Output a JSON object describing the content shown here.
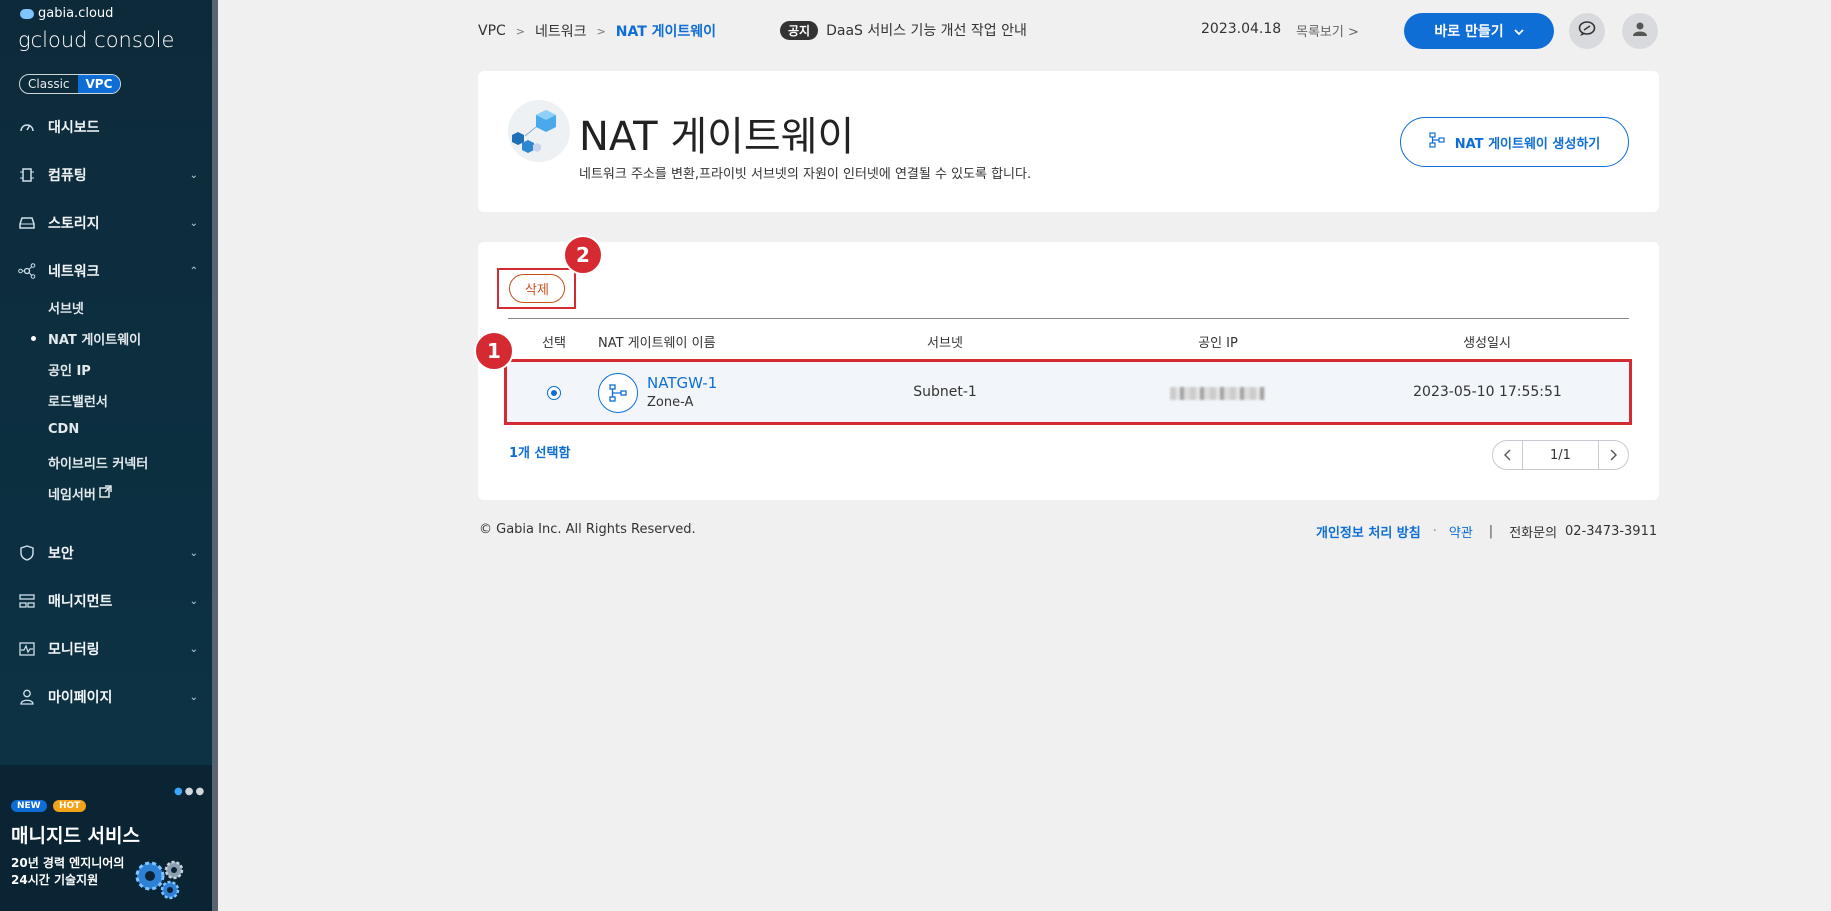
{
  "sidebar": {
    "brand_small": "gabia.cloud",
    "brand_big": "gcloud console",
    "mode_classic": "Classic",
    "mode_vpc": "VPC",
    "items": [
      {
        "label": "대시보드",
        "icon": "dashboard-icon"
      },
      {
        "label": "컴퓨팅",
        "icon": "chip-icon"
      },
      {
        "label": "스토리지",
        "icon": "storage-icon"
      },
      {
        "label": "네트워크",
        "icon": "network-icon"
      },
      {
        "label": "보안",
        "icon": "shield-icon"
      },
      {
        "label": "매니지먼트",
        "icon": "management-icon"
      },
      {
        "label": "모니터링",
        "icon": "monitor-icon"
      },
      {
        "label": "마이페이지",
        "icon": "user-icon"
      }
    ],
    "network_sub": [
      "서브넷",
      "NAT 게이트웨이",
      "공인 IP",
      "로드밸런서",
      "CDN",
      "하이브리드 커넥터",
      "네임서버"
    ],
    "promo": {
      "badge_new": "NEW",
      "badge_hot": "HOT",
      "title": "매니지드 서비스",
      "line1": "20년 경력 엔지니어의",
      "line2": "24시간 기술지원"
    }
  },
  "topbar": {
    "breadcrumb": [
      "VPC",
      "네트워크",
      "NAT 게이트웨이"
    ],
    "notice_tag": "공지",
    "notice_text": "DaaS 서비스 기능 개선 작업 안내",
    "notice_date": "2023.04.18",
    "notice_more": "목록보기",
    "quick_button": "바로 만들기"
  },
  "header": {
    "title": "NAT 게이트웨이",
    "description": "네트워크 주소를 변환,프라이빗 서브넷의 자원이 인터넷에 연결될 수 있도록 합니다.",
    "create_button": "NAT 게이트웨이 생성하기"
  },
  "list": {
    "delete_button": "삭제",
    "markers": [
      "1",
      "2"
    ],
    "columns": [
      "선택",
      "NAT 게이트웨이 이름",
      "서브넷",
      "공인 IP",
      "생성일시"
    ],
    "rows": [
      {
        "name": "NATGW-1",
        "zone": "Zone-A",
        "subnet": "Subnet-1",
        "created": "2023-05-10 17:55:51",
        "selected": true
      }
    ],
    "selected_count": "1개 선택함",
    "page_label": "1/1"
  },
  "footer": {
    "copyright": "© Gabia Inc. All Rights Reserved.",
    "privacy": "개인정보 처리 방침",
    "terms": "약관",
    "phone_label": "전화문의",
    "phone": "02-3473-3911"
  },
  "colors": {
    "accent": "#0f6ed6",
    "highlight": "#d62a33",
    "sidebar": "#0d2a3a"
  }
}
